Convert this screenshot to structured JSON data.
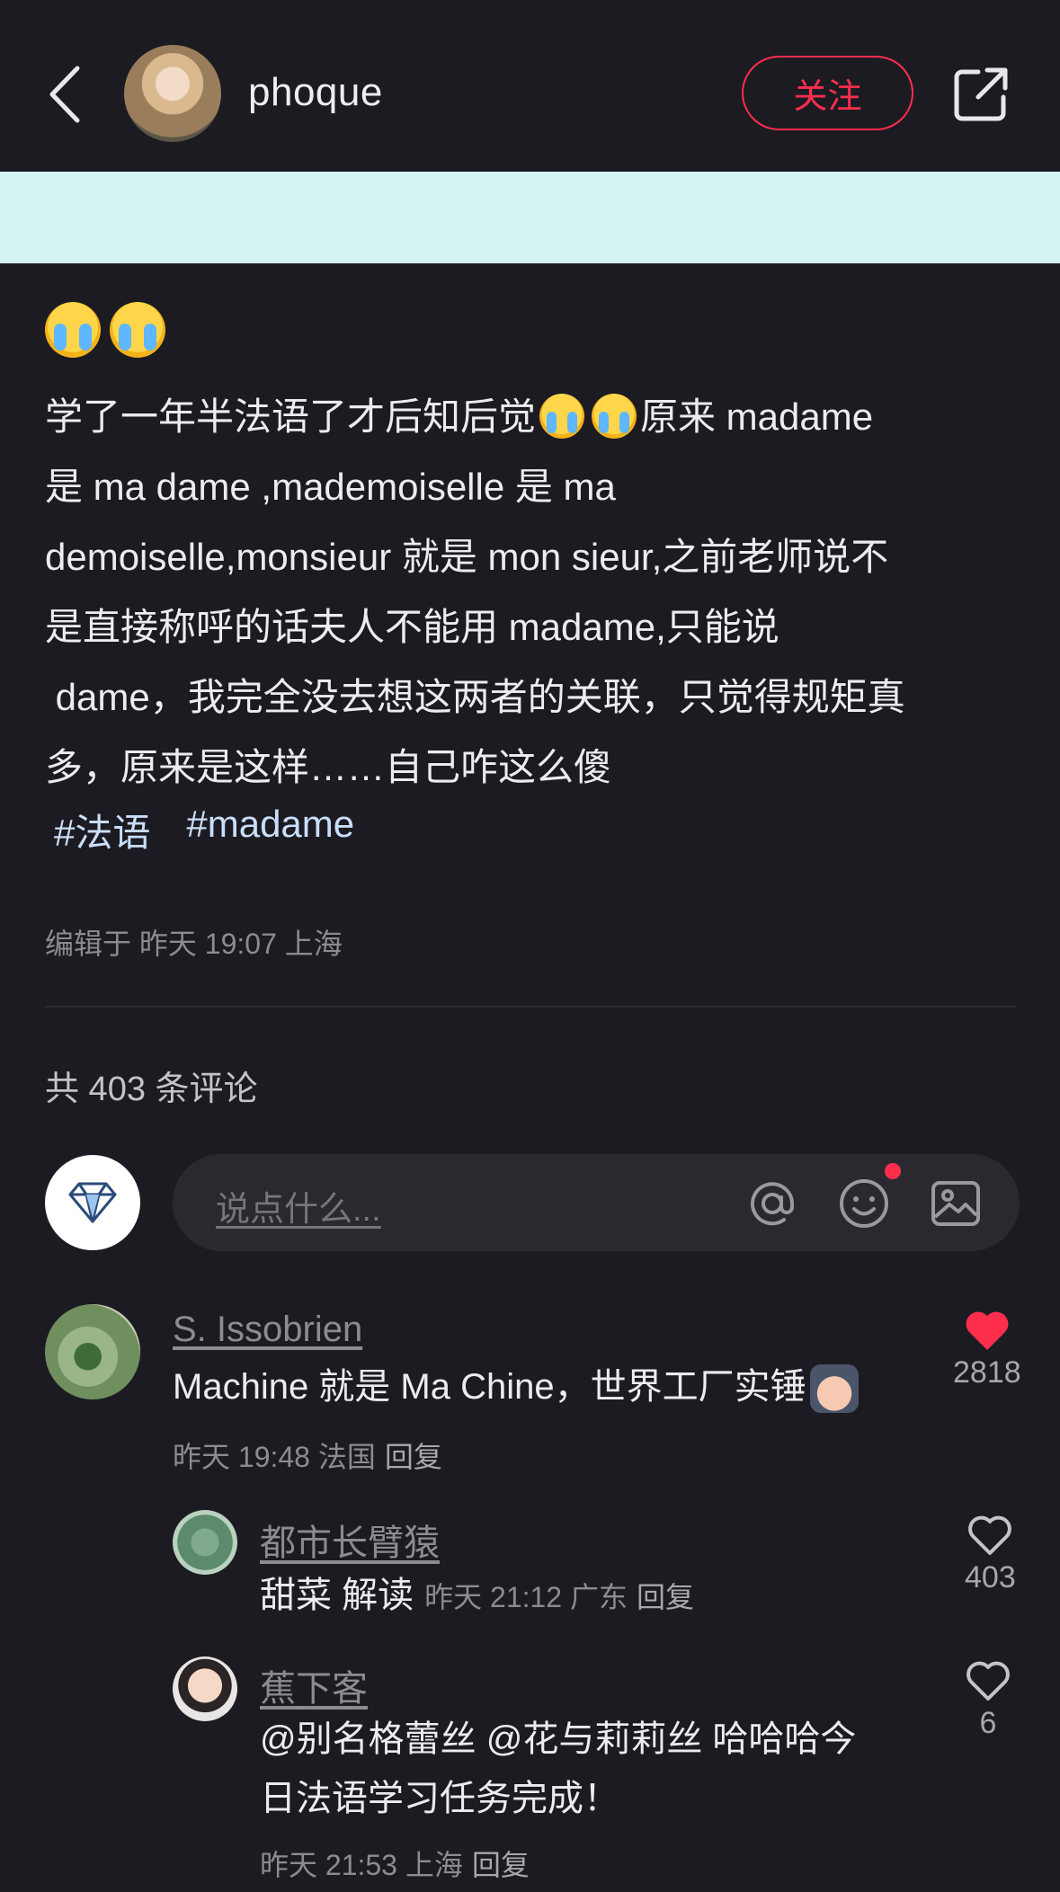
{
  "header": {
    "username": "phoque",
    "follow_label": "关注"
  },
  "post": {
    "lines": [
      "学了一年半法语了才后知后觉",
      "原来 madame",
      "是 ma dame ,mademoiselle 是 ma",
      "demoiselle,monsieur 就是 mon sieur,之前老师说不",
      "是直接称呼的话夫人不能用 madame,只能说",
      " dame，我完全没去想这两者的关联，只觉得规矩真",
      "多，原来是这样……自己咋这么傻"
    ],
    "tags": [
      "#法语",
      "#madame"
    ],
    "meta": "编辑于 昨天 19:07 上海"
  },
  "comments_section": {
    "count_label": "共 403 条评论",
    "input_placeholder": "说点什么..."
  },
  "comments": [
    {
      "name": "S. Issobrien",
      "text": "Machine 就是 Ma Chine，世界工厂实锤",
      "meta": "昨天 19:48 法国",
      "reply": "回复",
      "likes": "2818",
      "liked": true
    }
  ],
  "replies": [
    {
      "name": "都市长臂猿",
      "text": "甜菜 解读",
      "meta": "昨天 21:12 广东",
      "reply": "回复",
      "likes": "403"
    },
    {
      "name": "蕉下客",
      "text_line1": "@别名格蕾丝 @花与莉莉丝 哈哈哈今",
      "text_line2": "日法语学习任务完成！",
      "meta": "昨天 21:53 上海",
      "reply": "回复",
      "likes": "6"
    }
  ],
  "colors": {
    "background": "#1c1b22",
    "accent_red": "#ff2e4d",
    "banner": "#d5f4f2",
    "tag": "#c9def8"
  },
  "icons": [
    "back-icon",
    "share-icon",
    "at-icon",
    "emoji-icon",
    "image-icon",
    "diamond-icon",
    "heart-icon"
  ]
}
